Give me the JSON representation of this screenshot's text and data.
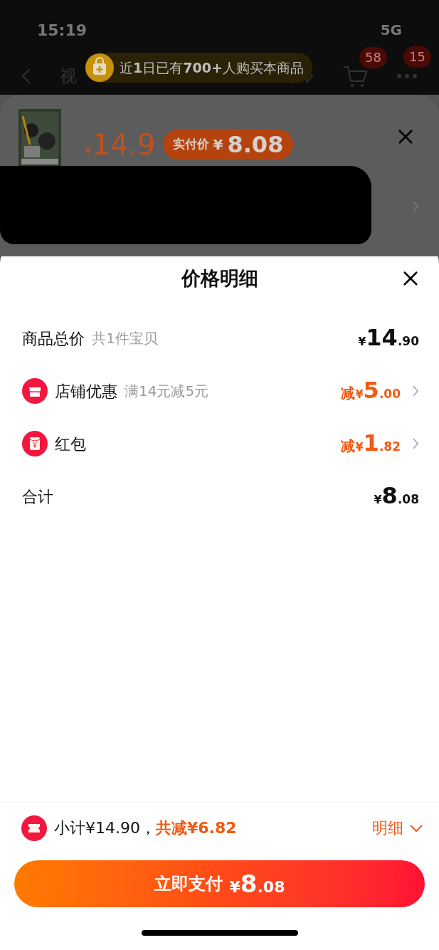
{
  "status_bar": {
    "time": "15:19",
    "network": "5G"
  },
  "nav": {
    "title": "视",
    "cart_badge": "58",
    "more_badge": "15"
  },
  "banner": {
    "parts": [
      {
        "text": "近",
        "bold": false
      },
      {
        "text": "1",
        "bold": true
      },
      {
        "text": "日已有",
        "bold": false
      },
      {
        "text": "700+",
        "bold": true
      },
      {
        "text": "人购买本商品",
        "bold": false
      }
    ]
  },
  "product": {
    "price": {
      "currency": "¥",
      "amount": "14.9"
    },
    "pay_chip": {
      "label": "实付价",
      "currency": "¥",
      "amount": "8.08"
    }
  },
  "sheet": {
    "title": "价格明细",
    "rows": [
      {
        "kind": "plain",
        "label": "商品总价",
        "note": "共1件宝贝",
        "amount": {
          "currency": "¥",
          "integer": "14",
          "decimal": ".90"
        }
      },
      {
        "kind": "shop",
        "label": "店铺优惠",
        "note": "满14元减5元",
        "amount": {
          "prefix": "减",
          "currency": "¥",
          "integer": "5",
          "decimal": ".00"
        }
      },
      {
        "kind": "envelope",
        "label": "红包",
        "amount": {
          "prefix": "减",
          "currency": "¥",
          "integer": "1",
          "decimal": ".82"
        }
      },
      {
        "kind": "plain",
        "label": "合计",
        "amount": {
          "currency": "¥",
          "integer": "8",
          "decimal": ".08"
        }
      }
    ]
  },
  "footer": {
    "subtotal": "小计¥14.90，",
    "saved": "共减¥6.82",
    "details": "明细",
    "pay_button": {
      "label": "立即支付",
      "currency": "¥",
      "integer": "8",
      "decimal": ".08"
    }
  }
}
